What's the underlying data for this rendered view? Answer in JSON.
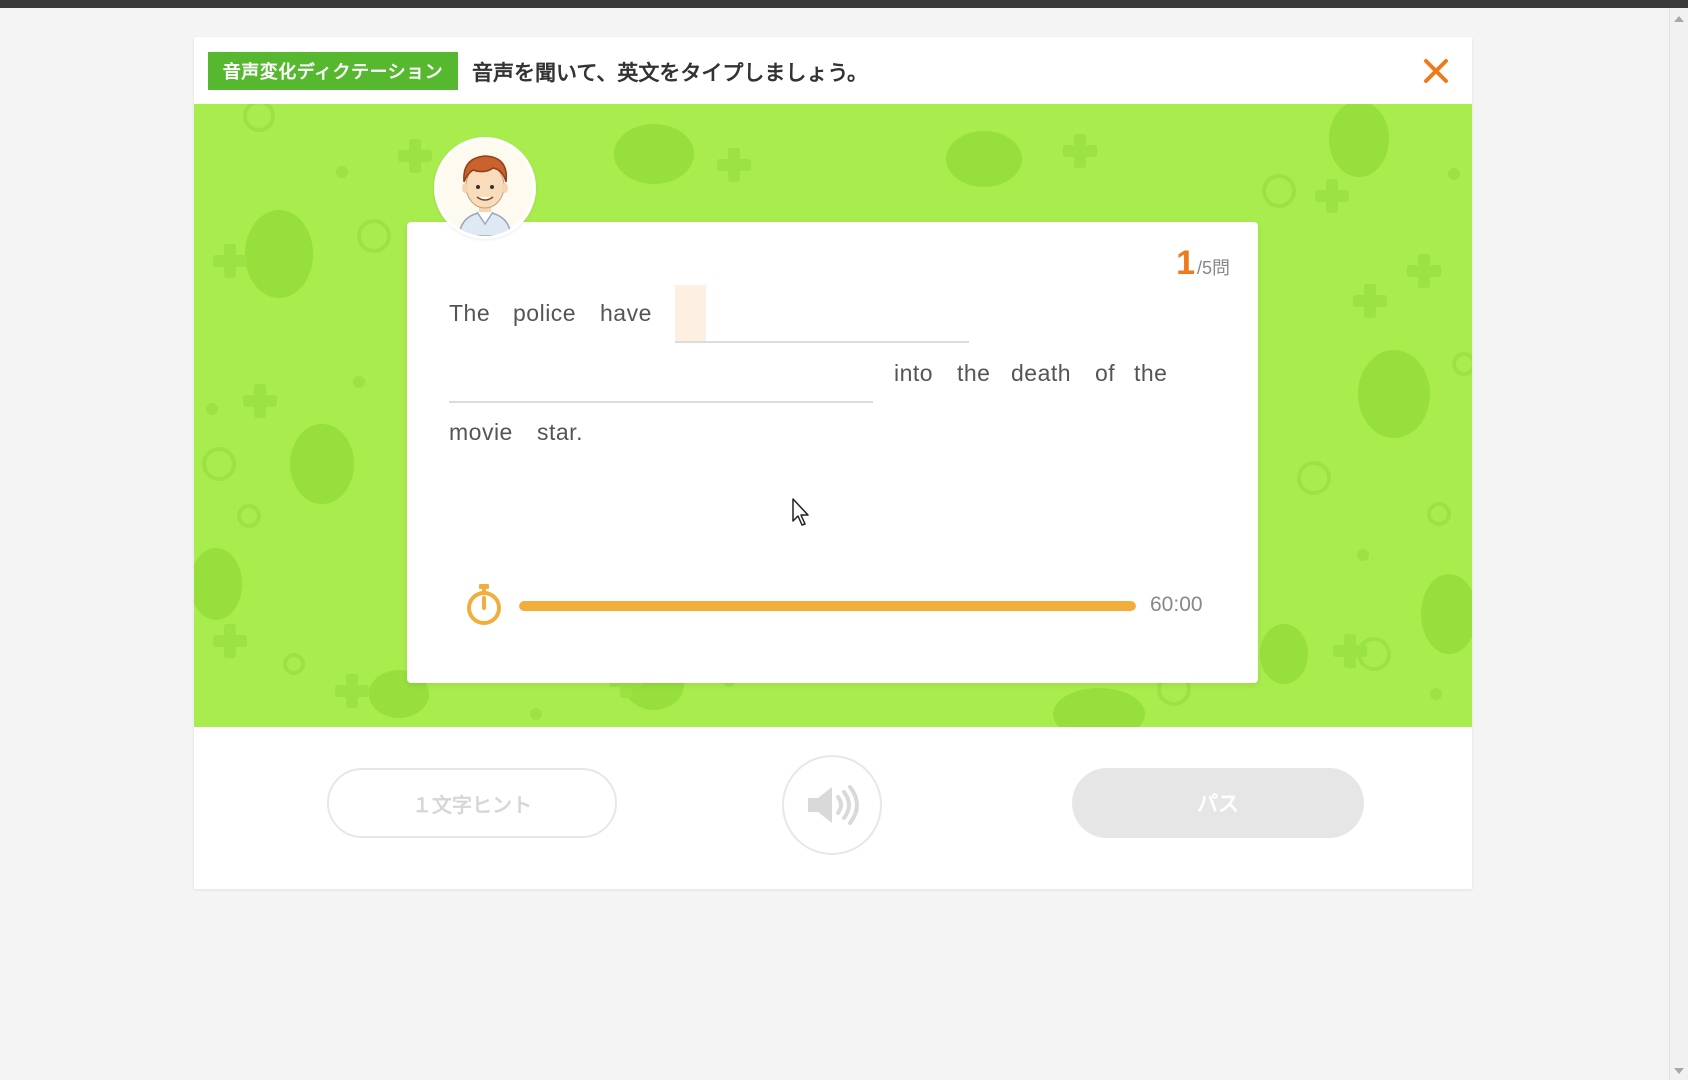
{
  "header": {
    "mode_badge": "音声変化ディクテーション",
    "instruction": "音声を聞いて、英文をタイプしましょう。",
    "close_icon": "close-icon"
  },
  "question": {
    "current": "1",
    "total": "/5問",
    "words": {
      "w1": "The",
      "w2": "police",
      "w3": "have",
      "w4": "into",
      "w5": "the",
      "w6": "death",
      "w7": "of",
      "w8": "the",
      "w9": "movie",
      "w10": "star."
    }
  },
  "timer": {
    "text": "60:00",
    "progress": 1.0,
    "icon": "stopwatch-icon"
  },
  "controls": {
    "hint_label": "１文字ヒント",
    "sound_icon": "speaker-icon",
    "pass_label": "パス"
  },
  "colors": {
    "accent_green": "#56b82f",
    "stage_green": "#a9ec4d",
    "accent_orange": "#ee7a1c",
    "timer_bar": "#f2ae3c",
    "disabled_grey": "#e6e6e6"
  }
}
